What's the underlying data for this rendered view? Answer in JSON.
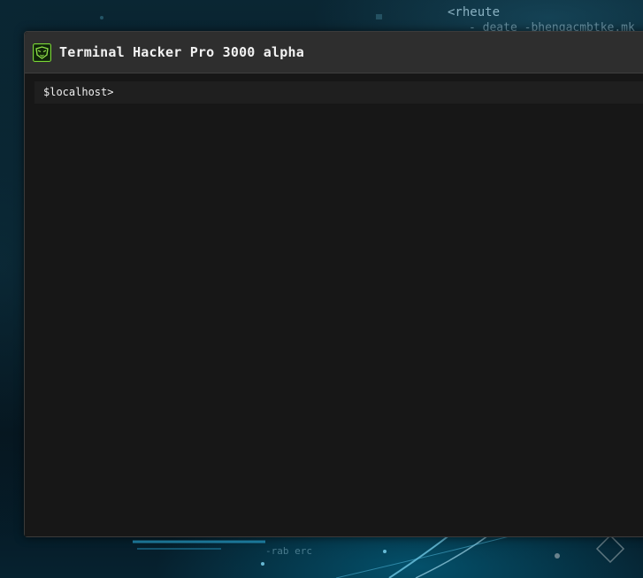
{
  "desktop": {
    "bg_code_lines": [
      "<rheute",
      "- deate -bhengacmbtke.mk",
      "-rab erc"
    ]
  },
  "window": {
    "title": "Terminal Hacker Pro 3000 alpha",
    "app_icon": "hacker-mask-icon"
  },
  "terminal": {
    "prompt": "$localhost>",
    "input_value": "",
    "colors": {
      "background": "#171717",
      "prompt_line": "#1f1f1f",
      "text": "#f0f0f0"
    }
  }
}
